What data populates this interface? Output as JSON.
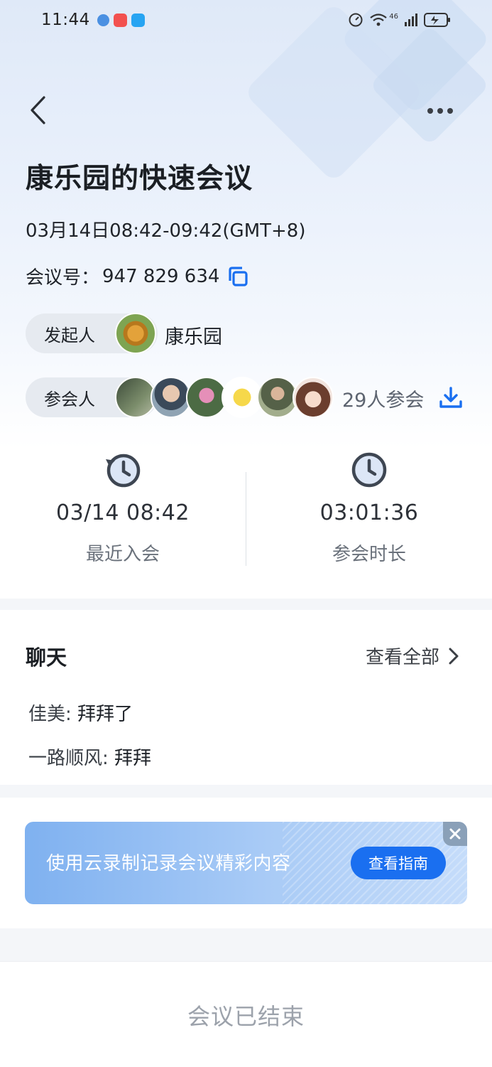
{
  "status_bar": {
    "time": "11:44",
    "network": "46"
  },
  "header": {
    "title": "康乐园的快速会议",
    "datetime": "03月14日08:42-09:42(GMT+8)",
    "meeting_no_label": "会议号：",
    "meeting_no": "947 829 634"
  },
  "host": {
    "label": "发起人",
    "name": "康乐园"
  },
  "attendees": {
    "label": "参会人",
    "count_text": "29人参会"
  },
  "stats": [
    {
      "value": "03/14 08:42",
      "label": "最近入会",
      "icon": "history-clock-icon"
    },
    {
      "value": "03:01:36",
      "label": "参会时长",
      "icon": "clock-icon"
    }
  ],
  "chat": {
    "title": "聊天",
    "view_all": "查看全部",
    "messages": [
      {
        "name": "佳美:",
        "text": "拜拜了"
      },
      {
        "name": "一路顺风:",
        "text": "拜拜"
      }
    ]
  },
  "banner": {
    "text": "使用云录制记录会议精彩内容",
    "button": "查看指南"
  },
  "footer": {
    "status": "会议已结束"
  },
  "colors": {
    "accent": "#1a6ff0",
    "muted_text": "#9ca2ab"
  }
}
